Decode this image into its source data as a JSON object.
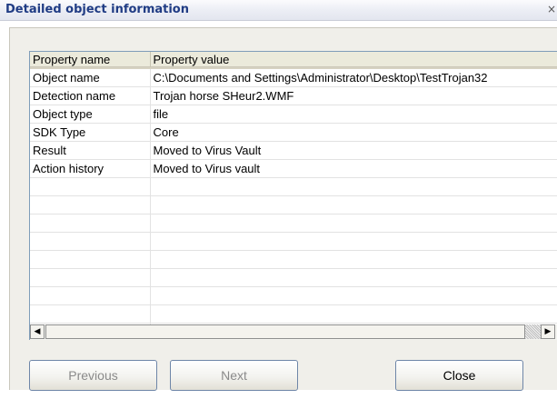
{
  "window": {
    "title": "Detailed object information",
    "close_glyph": "×"
  },
  "table": {
    "columns": [
      "Property name",
      "Property value"
    ],
    "rows": [
      [
        "Object name",
        "C:\\Documents and Settings\\Administrator\\Desktop\\TestTrojan32"
      ],
      [
        "Detection name",
        "Trojan horse SHeur2.WMF"
      ],
      [
        "Object type",
        "file"
      ],
      [
        "SDK Type",
        "Core"
      ],
      [
        "Result",
        "Moved to Virus Vault"
      ],
      [
        "Action history",
        "Moved to Virus vault"
      ]
    ]
  },
  "scrollbar": {
    "left_glyph": "◀",
    "right_glyph": "▶"
  },
  "buttons": {
    "previous": "Previous",
    "next": "Next",
    "close": "Close"
  }
}
